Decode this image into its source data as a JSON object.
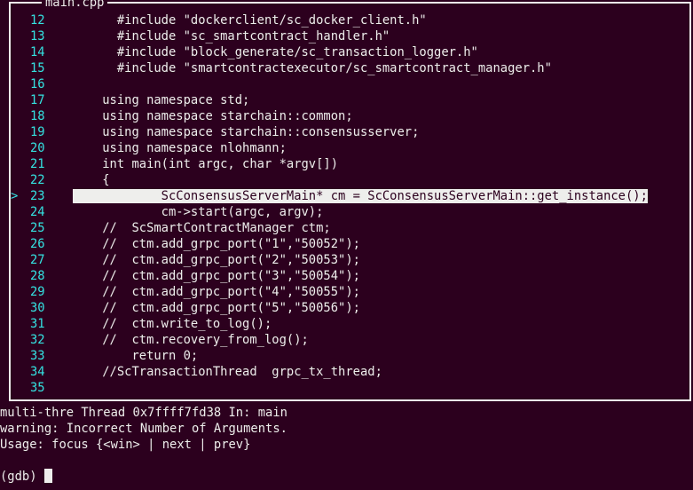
{
  "window": {
    "title": "main.cpp"
  },
  "source": {
    "current_line_index": 23,
    "lines": [
      {
        "num": "12",
        "text": "#include \"dockerclient/sc_docker_client.h\""
      },
      {
        "num": "13",
        "text": "#include \"sc_smartcontract_handler.h\""
      },
      {
        "num": "14",
        "text": "#include \"block_generate/sc_transaction_logger.h\""
      },
      {
        "num": "15",
        "text": "#include \"smartcontractexecutor/sc_smartcontract_manager.h\""
      },
      {
        "num": "16",
        "text": ""
      },
      {
        "num": "17",
        "text": "using namespace std;"
      },
      {
        "num": "18",
        "text": "using namespace starchain::common;"
      },
      {
        "num": "19",
        "text": "using namespace starchain::consensusserver;"
      },
      {
        "num": "20",
        "text": "using namespace nlohmann;"
      },
      {
        "num": "21",
        "text": "int main(int argc, char *argv[])"
      },
      {
        "num": "22",
        "text": "{"
      },
      {
        "num": "23",
        "text": "    ScConsensusServerMain* cm = ScConsensusServerMain::get_instance();",
        "current": true,
        "marker": ">"
      },
      {
        "num": "24",
        "text": "    cm->start(argc, argv);"
      },
      {
        "num": "25",
        "text": "//  ScSmartContractManager ctm;"
      },
      {
        "num": "26",
        "text": "//  ctm.add_grpc_port(\"1\",\"50052\");"
      },
      {
        "num": "27",
        "text": "//  ctm.add_grpc_port(\"2\",\"50053\");"
      },
      {
        "num": "28",
        "text": "//  ctm.add_grpc_port(\"3\",\"50054\");"
      },
      {
        "num": "29",
        "text": "//  ctm.add_grpc_port(\"4\",\"50055\");"
      },
      {
        "num": "30",
        "text": "//  ctm.add_grpc_port(\"5\",\"50056\");"
      },
      {
        "num": "31",
        "text": "//  ctm.write_to_log();"
      },
      {
        "num": "32",
        "text": "//  ctm.recovery_from_log();"
      },
      {
        "num": "33",
        "text": "  return 0;"
      },
      {
        "num": "34",
        "text": "//ScTransactionThread  grpc_tx_thread;"
      },
      {
        "num": "35",
        "text": ""
      }
    ]
  },
  "terminal": {
    "lines": [
      "multi-thre Thread 0x7ffff7fd38 In: main",
      "warning: Incorrect Number of Arguments.",
      "Usage: focus {<win> | next | prev}",
      "",
      "(gdb) "
    ],
    "prompt": "(gdb) "
  }
}
